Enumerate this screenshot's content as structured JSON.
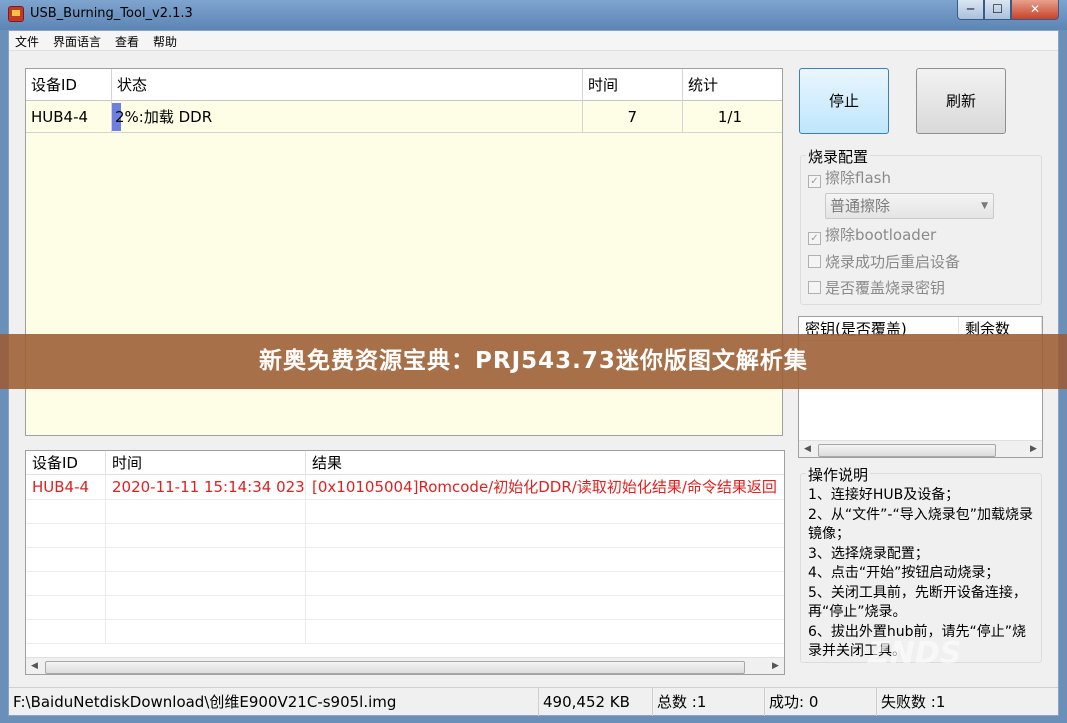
{
  "window": {
    "title": "USB_Burning_Tool_v2.1.3",
    "min": "─",
    "max": "☐",
    "close": "✕"
  },
  "menu": [
    "文件",
    "界面语言",
    "查看",
    "帮助"
  ],
  "device_table": {
    "headers": [
      "设备ID",
      "状态",
      "时间",
      "统计"
    ],
    "rows": [
      {
        "id": "HUB4-4",
        "status": "2%:加载 DDR",
        "progress": 0.02,
        "time": "7",
        "count": "1/1"
      }
    ]
  },
  "buttons": {
    "stop": "停止",
    "refresh": "刷新"
  },
  "config": {
    "title": "烧录配置",
    "erase_flash": {
      "label": "擦除flash",
      "checked": true
    },
    "erase_mode": "普通擦除",
    "erase_bootloader": {
      "label": "擦除bootloader",
      "checked": true
    },
    "reboot_after": {
      "label": "烧录成功后重启设备",
      "checked": false
    },
    "overwrite_key": {
      "label": "是否覆盖烧录密钥",
      "checked": false
    }
  },
  "key_list": {
    "headers": [
      "密钥(是否覆盖)",
      "剩余数"
    ]
  },
  "log_table": {
    "headers": [
      "设备ID",
      "时间",
      "结果"
    ],
    "rows": [
      {
        "id": "HUB4-4",
        "time": "2020-11-11 15:14:34 023",
        "result": "[0x10105004]Romcode/初始化DDR/读取初始化结果/命令结果返回"
      }
    ]
  },
  "instructions": {
    "title": "操作说明",
    "lines": [
      "1、连接好HUB及设备；",
      "2、从“文件”-“导入烧录包”加载烧录镜像；",
      "3、选择烧录配置；",
      "4、点击“开始”按钮启动烧录；",
      "5、关闭工具前，先断开设备连接，再“停止”烧录。",
      "6、拔出外置hub前，请先“停止”烧录并关闭工具。"
    ]
  },
  "status_bar": {
    "path": "F:\\BaiduNetdiskDownload\\创维E900V21C-s905l.img",
    "size": "490,452 KB",
    "total": "总数 :1",
    "success": "成功:  0",
    "fail": "失败数 :1"
  },
  "banner": "新奥免费资源宝典：PRJ543.73迷你版图文解析集",
  "watermark": "ZNDS"
}
